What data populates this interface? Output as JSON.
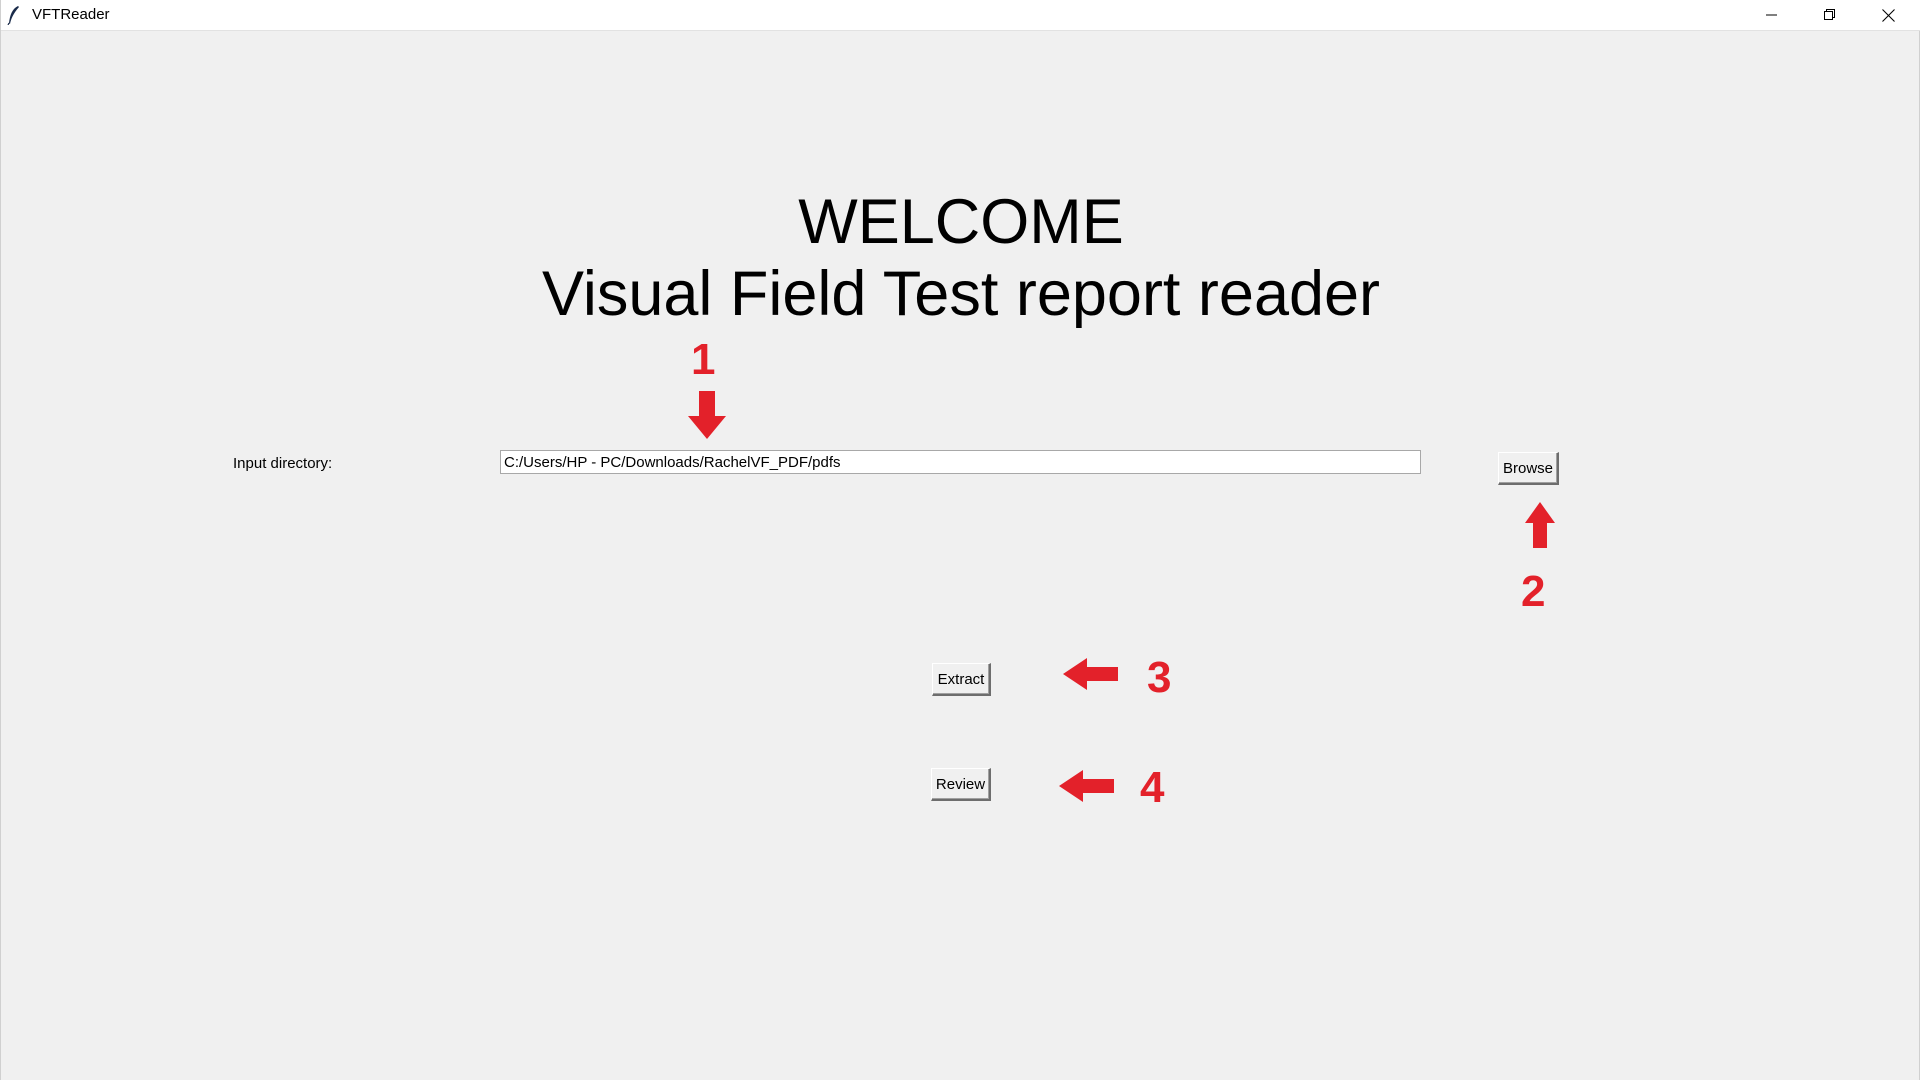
{
  "window": {
    "title": "VFTReader",
    "controls": {
      "minimize": "minimize-icon",
      "restore": "restore-icon",
      "close": "close-icon"
    }
  },
  "main": {
    "heading_line1": "WELCOME",
    "heading_line2": "Visual Field Test report reader",
    "input_label": "Input directory:",
    "input_value": "C:/Users/HP - PC/Downloads/RachelVF_PDF/pdfs",
    "browse_label": "Browse",
    "extract_label": "Extract",
    "review_label": "Review"
  },
  "annotations": {
    "color": "#e3212a",
    "step1": "1",
    "step2": "2",
    "step3": "3",
    "step4": "4"
  }
}
